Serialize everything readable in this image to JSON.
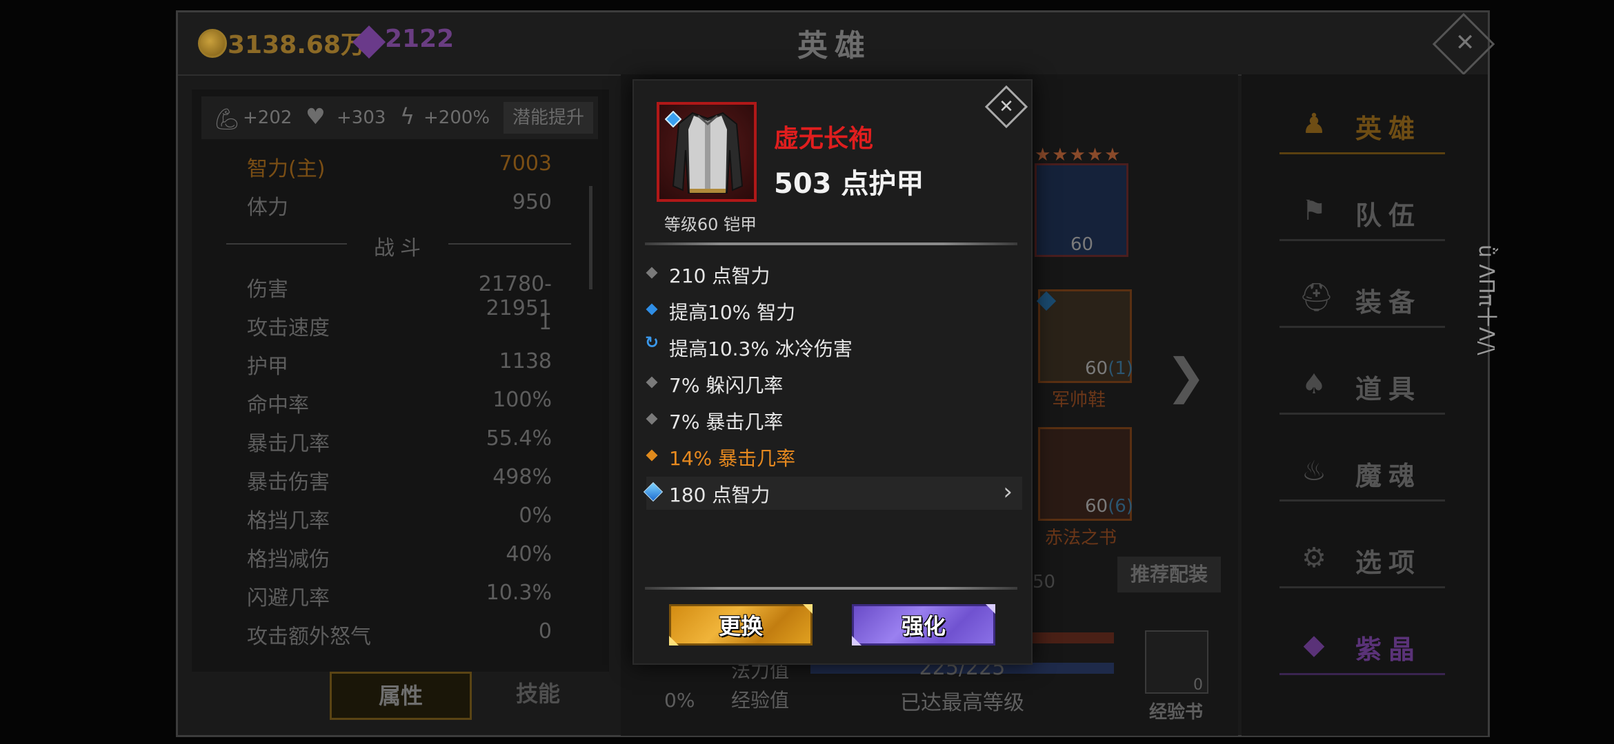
{
  "header": {
    "gold": "3138.68万",
    "gems": "2122",
    "title": "英雄"
  },
  "bonus_bar": {
    "strength": "+202",
    "health": "+303",
    "energy": "+200%",
    "potential_button": "潜能提升"
  },
  "stats": {
    "primary": [
      {
        "label": "智力(主)",
        "value": "7003"
      },
      {
        "label": "体力",
        "value": "950"
      }
    ],
    "combat_header": "战斗",
    "combat": [
      {
        "label": "伤害",
        "value": "21780-21951"
      },
      {
        "label": "攻击速度",
        "value": "1"
      },
      {
        "label": "护甲",
        "value": "1138"
      },
      {
        "label": "命中率",
        "value": "100%"
      },
      {
        "label": "暴击几率",
        "value": "55.4%"
      },
      {
        "label": "暴击伤害",
        "value": "498%"
      },
      {
        "label": "格挡几率",
        "value": "0%"
      },
      {
        "label": "格挡减伤",
        "value": "40%"
      },
      {
        "label": "闪避几率",
        "value": "10.3%"
      },
      {
        "label": "攻击额外怒气",
        "value": "0"
      }
    ]
  },
  "tabs": {
    "attributes": "属性",
    "skills": "技能"
  },
  "hero_area": {
    "dragon_level": "60",
    "boots_level": "60",
    "boots_sockets": "(1)",
    "boots_name": "军帅鞋",
    "book_level": "60",
    "book_sockets": "(6)",
    "book_name": "赤法之书",
    "recommend_button": "推荐配装",
    "partial_number": "50",
    "mana_label": "法力值",
    "mana_value": "225/225",
    "exp_label": "经验值",
    "exp_value": "已达最高等级",
    "percent": "0%",
    "exp_book_label": "经验书",
    "exp_book_count": "0",
    "uuid_fragment": "le7280f6b-2e43-4f0e-8b19"
  },
  "nav": [
    {
      "label": "英雄",
      "icon": "heroes-icon",
      "glyph": "♟"
    },
    {
      "label": "队伍",
      "icon": "flag-icon",
      "glyph": "⚑"
    },
    {
      "label": "装备",
      "icon": "helmet-icon",
      "glyph": "⛑"
    },
    {
      "label": "道具",
      "icon": "bag-icon",
      "glyph": "♠"
    },
    {
      "label": "魔魂",
      "icon": "flame-icon",
      "glyph": "♨"
    },
    {
      "label": "选项",
      "icon": "gear-icon",
      "glyph": "⚙"
    },
    {
      "label": "紫晶",
      "icon": "crystal-icon",
      "glyph": "◆"
    }
  ],
  "side_text": "ǜ ΛΠπ十Λ/\\",
  "popup": {
    "item_name": "虚无长袍",
    "armor": "503 点护甲",
    "level_type": "等级60 铠甲",
    "affixes": [
      {
        "text": "210 点智力",
        "bullet": "gray"
      },
      {
        "text": "提高10% 智力",
        "bullet": "blue"
      },
      {
        "text": "提高10.3% 冰冷伤害",
        "bullet": "cycle"
      },
      {
        "text": "7% 躲闪几率",
        "bullet": "gray"
      },
      {
        "text": "7% 暴击几率",
        "bullet": "gray"
      },
      {
        "text": "14% 暴击几率",
        "bullet": "orange"
      },
      {
        "text": "180 点智力",
        "bullet": "gem"
      }
    ],
    "replace_button": "更换",
    "enhance_button": "强化"
  },
  "colors": {
    "item_name_red": "#e01e1e",
    "legendary_orange": "#e6891f",
    "replace_gold": "#e6a42a",
    "enhance_purple": "#8a6ee6"
  }
}
